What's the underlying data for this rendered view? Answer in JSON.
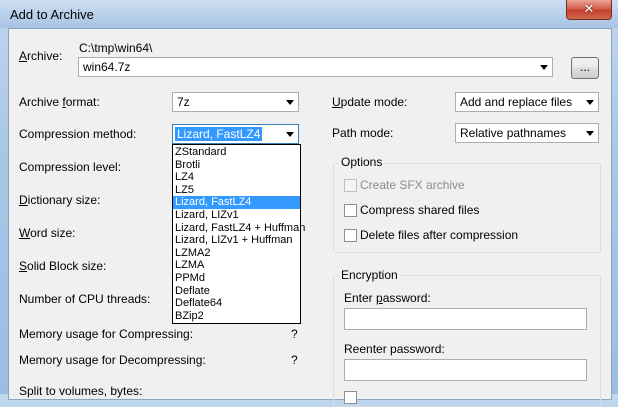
{
  "window": {
    "title": "Add to Archive",
    "close_glyph": "✕"
  },
  "archive": {
    "label": "Archive:",
    "path": "C:\\tmp\\win64\\",
    "name": "win64.7z",
    "browse_label": "..."
  },
  "left": {
    "format_label": "Archive format:",
    "format_value": "7z",
    "method_label": "Compression method:",
    "method_value": "Lizard, FastLZ4",
    "level_label": "Compression level:",
    "dict_label": "Dictionary size:",
    "word_label": "Word size:",
    "solid_label": "Solid Block size:",
    "threads_label": "Number of CPU threads:",
    "mem_comp_label": "Memory usage for Compressing:",
    "mem_comp_value": "?",
    "mem_decomp_label": "Memory usage for Decompressing:",
    "mem_decomp_value": "?",
    "split_label": "Split to volumes, bytes:"
  },
  "method_options": [
    "ZStandard",
    "Brotli",
    "LZ4",
    "LZ5",
    "Lizard, FastLZ4",
    "Lizard, LIZv1",
    "Lizard, FastLZ4 + Huffman",
    "Lizard, LIZv1 + Huffman",
    "LZMA2",
    "LZMA",
    "PPMd",
    "Deflate",
    "Deflate64",
    "BZip2"
  ],
  "method_selected_index": 4,
  "right": {
    "update_label": "Update mode:",
    "update_value": "Add and replace files",
    "path_label": "Path mode:",
    "path_value": "Relative pathnames"
  },
  "options": {
    "title": "Options",
    "sfx_label": "Create SFX archive",
    "shared_label": "Compress shared files",
    "delete_label": "Delete files after compression"
  },
  "encryption": {
    "title": "Encryption",
    "enter_label": "Enter password:",
    "reenter_label": "Reenter password:"
  }
}
